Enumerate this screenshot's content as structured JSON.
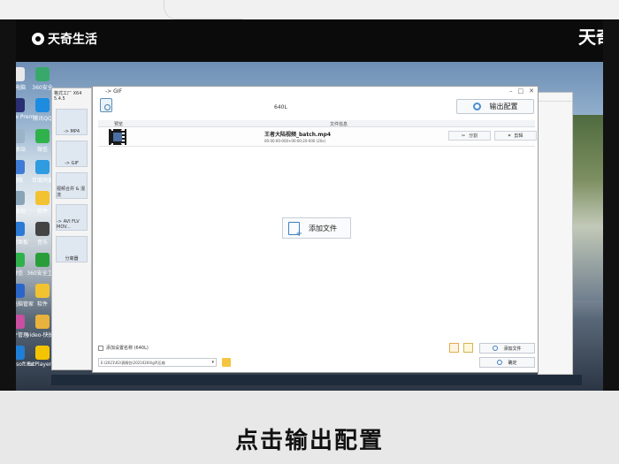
{
  "brand": {
    "left": "天奇生活",
    "right": "天奇"
  },
  "desktop_icons": [
    {
      "label": "此电脑"
    },
    {
      "label": "360安全"
    },
    {
      "label": "Adobe Premie..."
    },
    {
      "label": "腾讯QQ"
    },
    {
      "label": "回收站"
    },
    {
      "label": "微信"
    },
    {
      "label": "网络"
    },
    {
      "label": "百度网盘"
    },
    {
      "label": "回收站"
    },
    {
      "label": "软件"
    },
    {
      "label": "控制面板"
    },
    {
      "label": "音乐"
    },
    {
      "label": "微信"
    },
    {
      "label": "360安全卫士"
    },
    {
      "label": "腾讯电脑管家"
    },
    {
      "label": "软件"
    },
    {
      "label": "软件管理"
    },
    {
      "label": "video-快捷方式"
    },
    {
      "label": "Microsoft Edge"
    },
    {
      "label": "PotPlayer 64 bit"
    }
  ],
  "back_window": {
    "title": "格式工厂 X64 5.4.5",
    "sidebar": [
      "-> MP4",
      "-> GIF",
      "视频合并 & 混流",
      "-> AVI FLV MOV...",
      "分离器"
    ]
  },
  "dialog": {
    "title": "-> GIF",
    "format_label": "640L",
    "output_config_label": "输出配置",
    "table": {
      "col_preview": "预览",
      "col_name": "文件信息"
    },
    "file": {
      "name": "王者大陆视频_batch.mp4",
      "info": "00:00:00-000+00:00:20-000 (20s)"
    },
    "split_label": "分割",
    "crop_label": "剪辑",
    "add_file_center": "添加文件",
    "add_dir_checkbox": "添加设置名称 (640L)",
    "output_path": "E:\\2021\\02\\表情包\\20210204\\gif\\压缩",
    "add_file_btn": "添加文件",
    "ok_btn": "确定"
  },
  "caption": "点击输出配置",
  "colors": {
    "accent": "#4a8ed0"
  }
}
